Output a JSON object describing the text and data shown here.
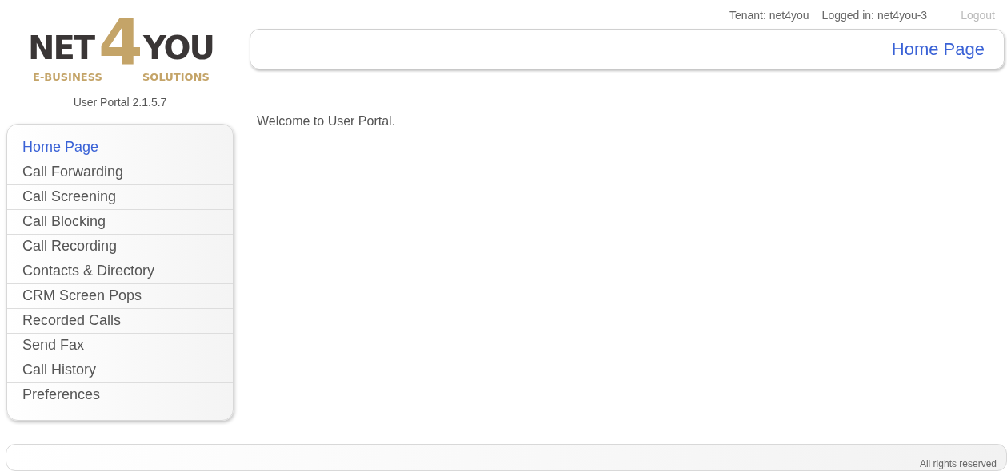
{
  "logo": {
    "left": "NET",
    "middle": "4",
    "right": "YOU",
    "tagline_left": "E-BUSINESS",
    "tagline_right": "SOLUTIONS"
  },
  "version": "User Portal 2.1.5.7",
  "top_bar": {
    "tenant": "Tenant: net4you",
    "logged_in": "Logged in: net4you-3",
    "logout": "Logout"
  },
  "page_title": "Home Page",
  "sidebar": {
    "items": [
      {
        "label": "Home Page",
        "selected": true
      },
      {
        "label": "Call Forwarding",
        "selected": false
      },
      {
        "label": "Call Screening",
        "selected": false
      },
      {
        "label": "Call Blocking",
        "selected": false
      },
      {
        "label": "Call Recording",
        "selected": false
      },
      {
        "label": "Contacts & Directory",
        "selected": false
      },
      {
        "label": "CRM Screen Pops",
        "selected": false
      },
      {
        "label": "Recorded Calls",
        "selected": false
      },
      {
        "label": "Send Fax",
        "selected": false
      },
      {
        "label": "Call History",
        "selected": false
      },
      {
        "label": "Preferences",
        "selected": false
      }
    ]
  },
  "content": {
    "welcome": "Welcome to User Portal."
  },
  "footer": {
    "text": "All rights reserved"
  }
}
